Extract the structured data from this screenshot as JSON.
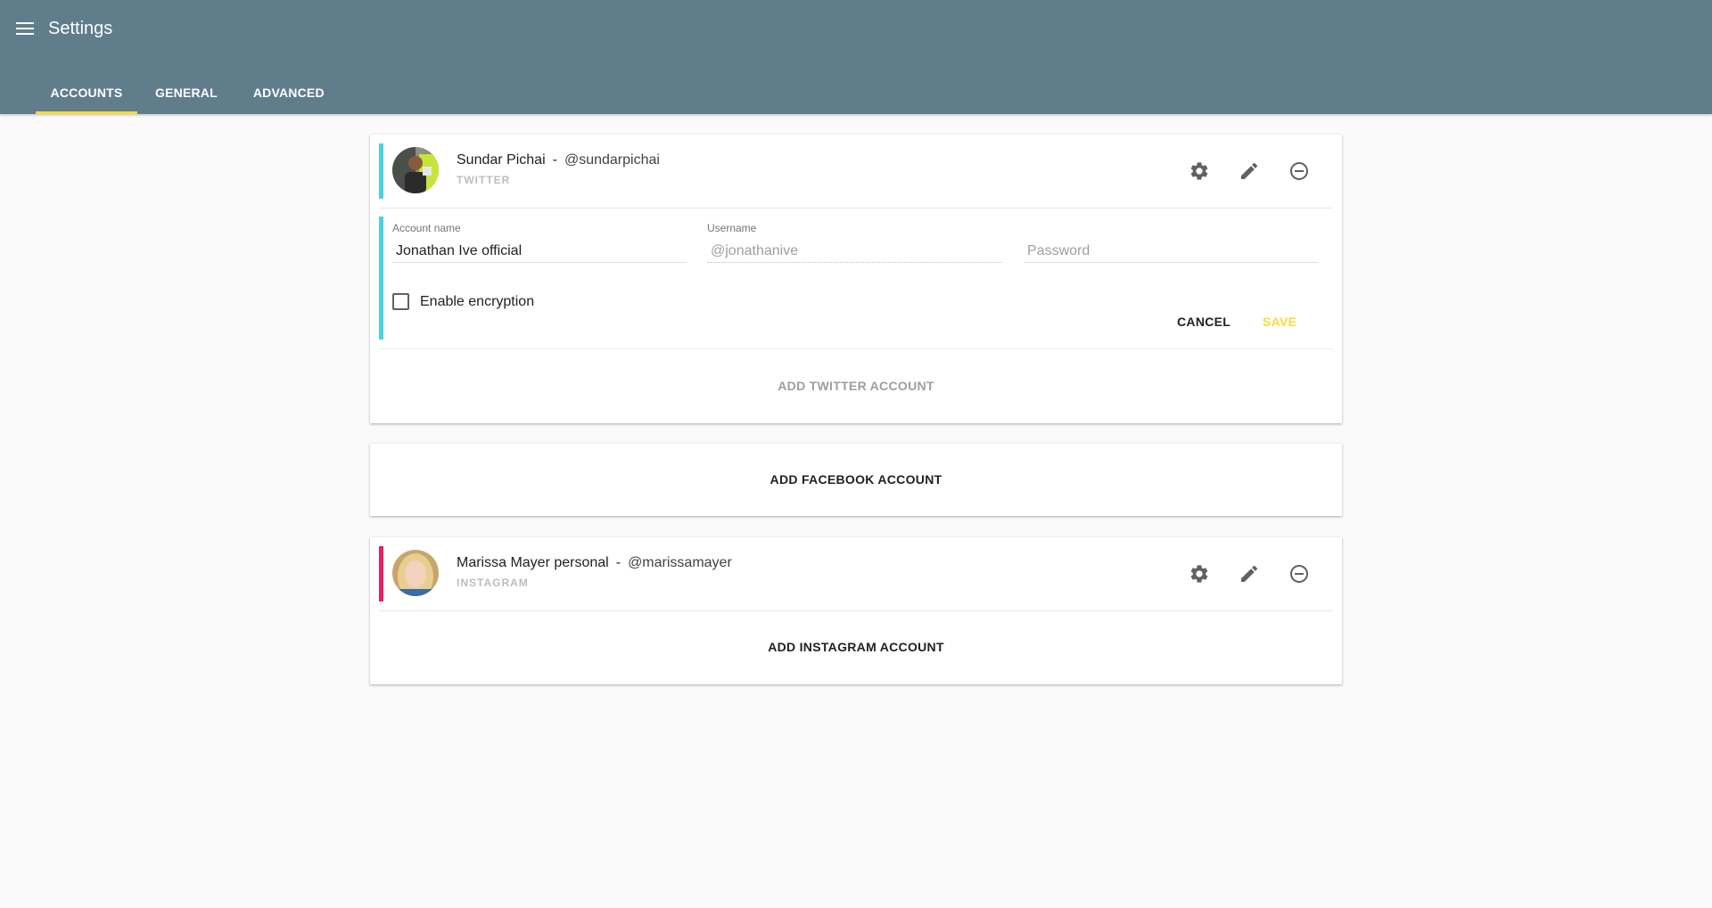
{
  "app": {
    "title": "Settings",
    "colors": {
      "appbar": "#607d8b",
      "tab_indicator": "#fdd835",
      "twitter_accent": "#4dd0e1",
      "instagram_accent": "#e91e63",
      "save": "#fdd835"
    }
  },
  "tabs": [
    {
      "label": "ACCOUNTS",
      "active": true
    },
    {
      "label": "GENERAL",
      "active": false
    },
    {
      "label": "ADVANCED",
      "active": false
    }
  ],
  "twitter_card": {
    "account": {
      "name": "Sundar Pichai",
      "separator": "-",
      "handle": "@sundarpichai",
      "network": "TWITTER"
    },
    "form": {
      "account_name_label": "Account name",
      "account_name_value": "Jonathan Ive official",
      "username_label": "Username",
      "username_value": "@jonathanive",
      "password_placeholder": "Password",
      "encryption_label": "Enable encryption",
      "encryption_checked": false,
      "cancel_label": "CANCEL",
      "save_label": "SAVE"
    },
    "add_label": "ADD TWITTER ACCOUNT"
  },
  "facebook_card": {
    "add_label": "ADD FACEBOOK ACCOUNT"
  },
  "instagram_card": {
    "account": {
      "name": "Marissa Mayer personal",
      "separator": "-",
      "handle": "@marissamayer",
      "network": "INSTAGRAM"
    },
    "add_label": "ADD INSTAGRAM ACCOUNT"
  },
  "icons": [
    "menu-icon",
    "gear-icon",
    "pencil-icon",
    "minus-circle-icon"
  ]
}
